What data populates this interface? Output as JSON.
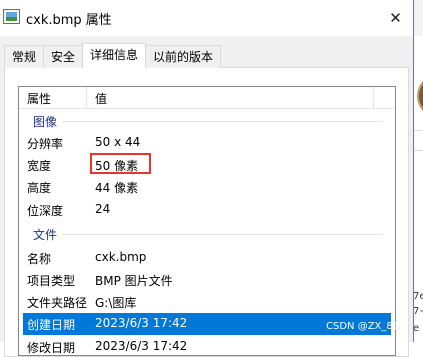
{
  "window": {
    "title": "cxk.bmp 属性",
    "close_glyph": "✕"
  },
  "tabs": [
    {
      "label": "常规",
      "active": false
    },
    {
      "label": "安全",
      "active": false
    },
    {
      "label": "详细信息",
      "active": true
    },
    {
      "label": "以前的版本",
      "active": false
    }
  ],
  "list": {
    "columns": {
      "name": "属性",
      "value": "值"
    },
    "groups": {
      "image": "图像",
      "file": "文件"
    },
    "image_rows": [
      {
        "name": "分辨率",
        "value": "50 x 44"
      },
      {
        "name": "宽度",
        "value": "50 像素"
      },
      {
        "name": "高度",
        "value": "44 像素"
      },
      {
        "name": "位深度",
        "value": "24"
      }
    ],
    "file_rows": [
      {
        "name": "名称",
        "value": "cxk.bmp"
      },
      {
        "name": "项目类型",
        "value": "BMP 图片文件"
      },
      {
        "name": "文件夹路径",
        "value": "G:\\图库"
      },
      {
        "name": "创建日期",
        "value": "2023/6/3 17:42",
        "selected": true
      },
      {
        "name": "修改日期",
        "value": "2023/6/3 17:42"
      }
    ]
  },
  "background_window": {
    "lines": [
      "7e",
      "7+",
      "e"
    ]
  },
  "watermark": "CSDN @ZX_815",
  "colors": {
    "selection": "#0078d7",
    "group_header": "#1e3287",
    "annotation_box": "#e8352b"
  }
}
